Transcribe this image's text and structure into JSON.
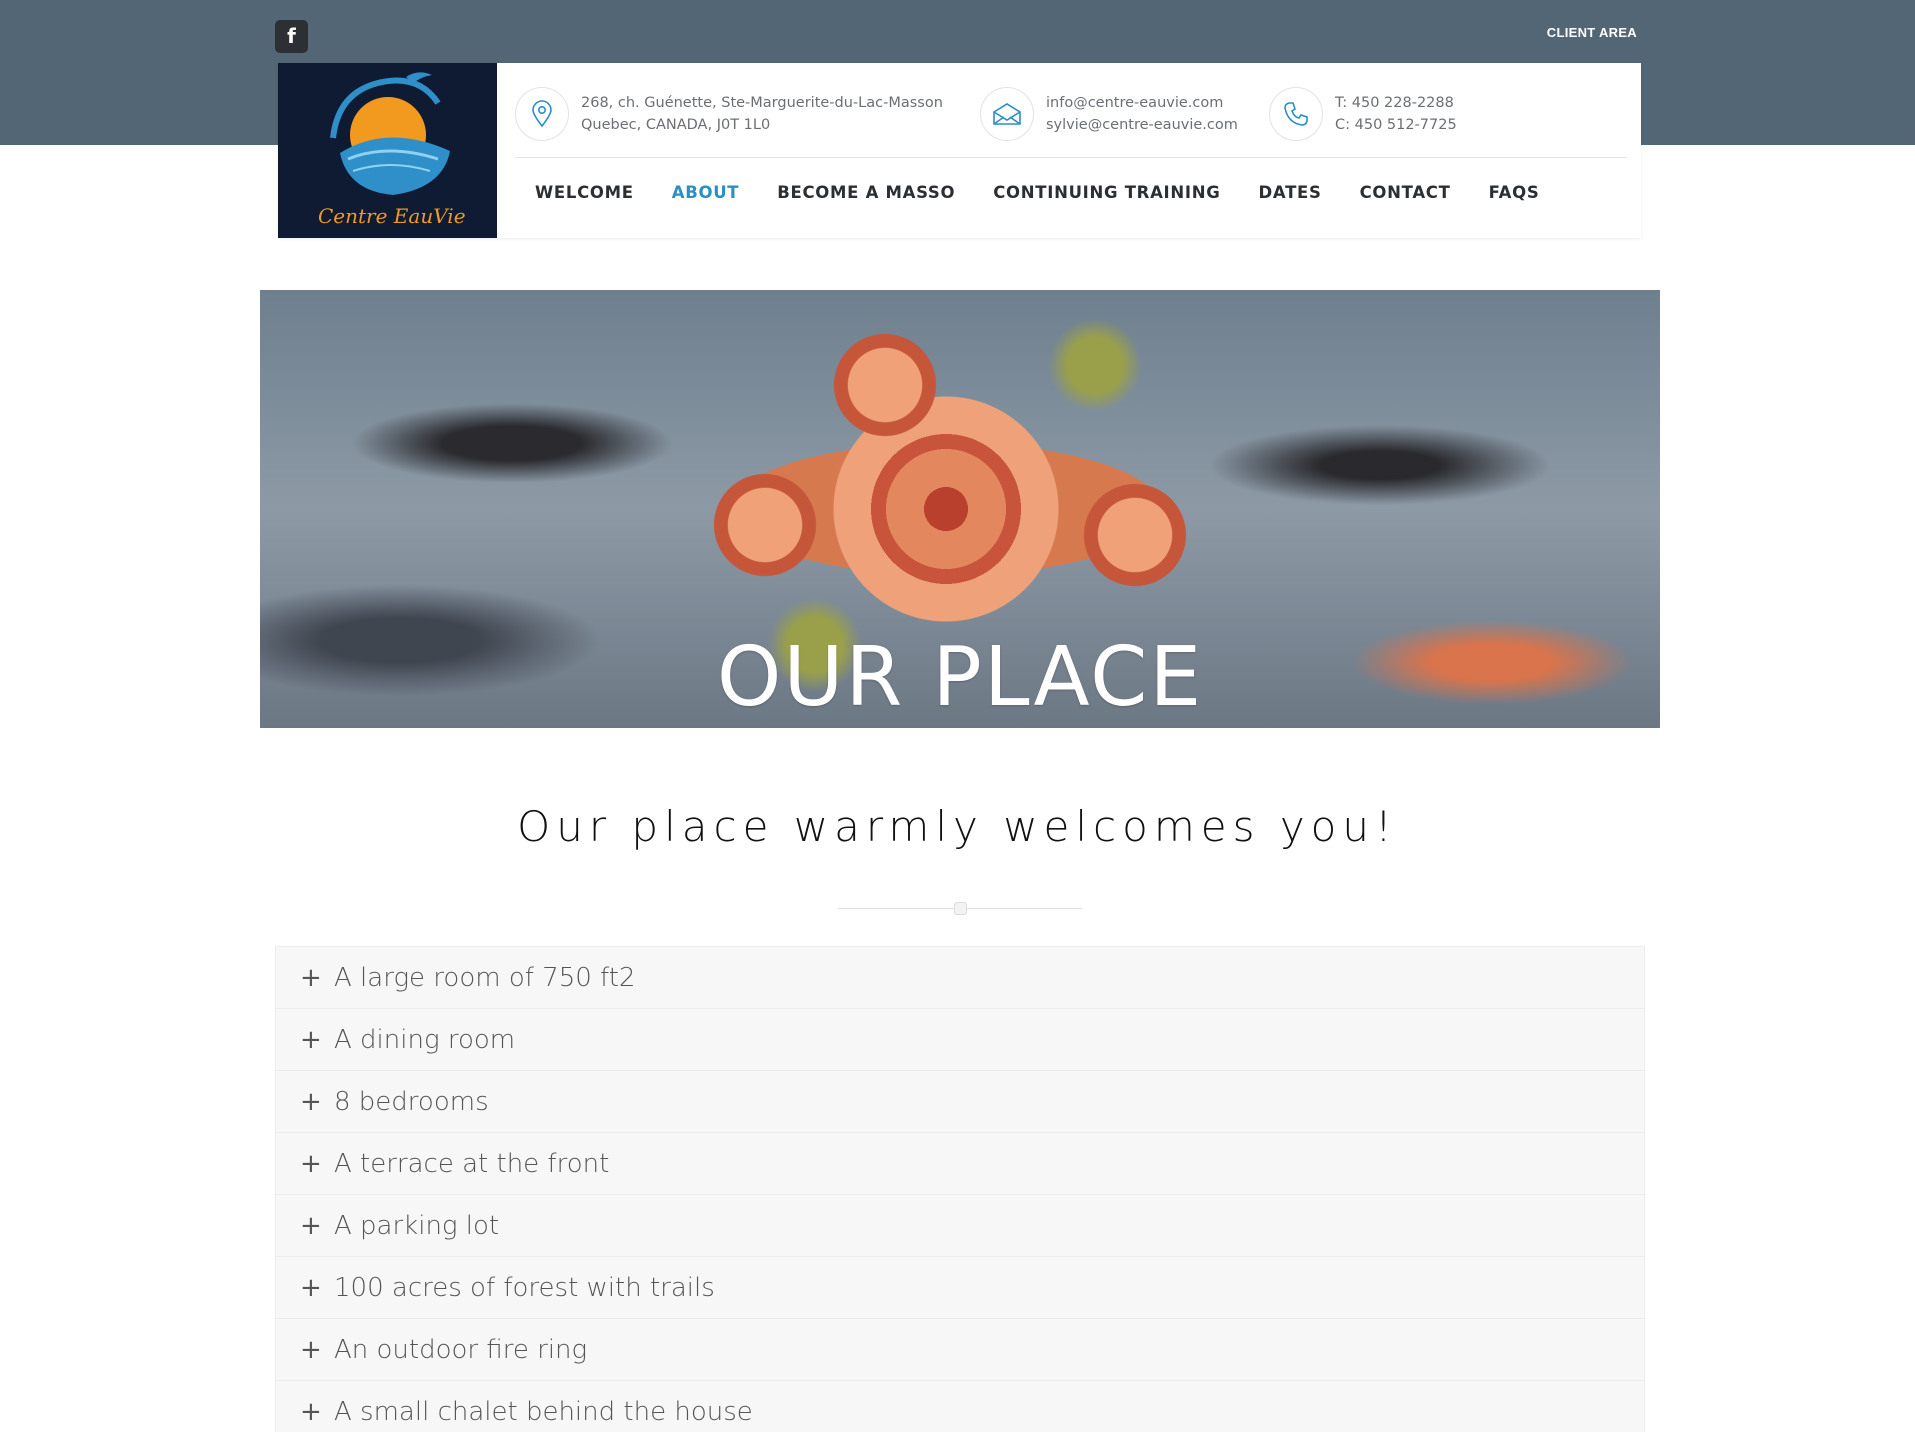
{
  "topbar": {
    "facebook_icon": "facebook-icon",
    "client_area": "CLIENT AREA"
  },
  "logo": {
    "text": "Centre EauVie",
    "colors": {
      "background": "#0f1b33",
      "sun": "#f29a1f",
      "water": "#2f8fc9"
    }
  },
  "contact": {
    "address_line1": "268, ch. Guénette, Ste-Marguerite-du-Lac-Masson",
    "address_line2": "Quebec, CANADA, J0T 1L0",
    "email_line1": "info@centre-eauvie.com",
    "email_line2": "sylvie@centre-eauvie.com",
    "phone_line1": "T: 450 228-2288",
    "phone_line2": "C: 450 512-7725",
    "icons": [
      "location-pin-icon",
      "envelope-icon",
      "phone-icon"
    ]
  },
  "nav": {
    "items": [
      {
        "label": "WELCOME"
      },
      {
        "label": "ABOUT"
      },
      {
        "label": "BECOME A MASSO"
      },
      {
        "label": "CONTINUING TRAINING"
      },
      {
        "label": "DATES"
      },
      {
        "label": "CONTACT"
      },
      {
        "label": "FAQS"
      }
    ],
    "active": "ABOUT",
    "active_color": "#2a8fc4"
  },
  "hero": {
    "title": "OUR PLACE"
  },
  "main": {
    "subtitle": "Our place warmly welcomes you!"
  },
  "accordion": {
    "items": [
      {
        "label": "A large room of 750 ft2"
      },
      {
        "label": "A dining room"
      },
      {
        "label": "8 bedrooms"
      },
      {
        "label": "A terrace at the front"
      },
      {
        "label": "A parking lot"
      },
      {
        "label": "100 acres of forest with trails"
      },
      {
        "label": "An outdoor fire ring"
      },
      {
        "label": "A small chalet behind the house"
      }
    ],
    "expand_icon": "plus-icon"
  }
}
